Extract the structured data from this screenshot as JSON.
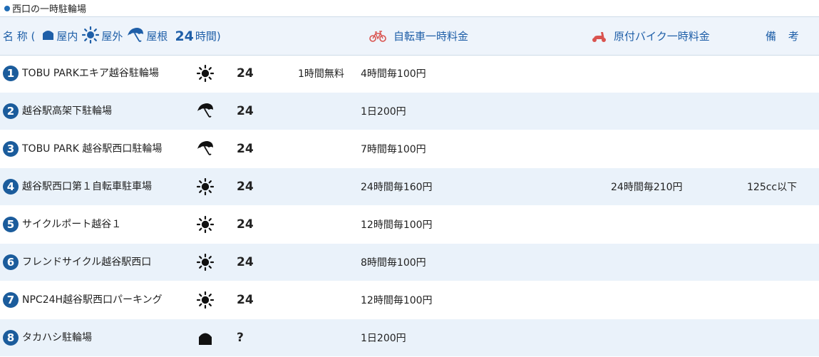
{
  "section_title": "西口の一時駐輪場",
  "header": {
    "name_label": "名 称 (",
    "indoor": "屋内",
    "outdoor": "屋外",
    "roof": "屋根",
    "hours_num": "24",
    "hours_label": "時間)",
    "bike_fee": "自転車一時料金",
    "moto_fee": "原付バイク一時料金",
    "note": "備 考"
  },
  "colors": {
    "accent": "#1f5fa8",
    "row_alt": "#eaf2fa",
    "number_badge": "#1b5c9c"
  },
  "rows": [
    {
      "num": "1",
      "name": "TOBU PARKエキア越谷駐輪場",
      "type": "sun-icon",
      "hours": "24",
      "free": "1時間無料",
      "bike": "4時間毎100円",
      "moto": "",
      "note": ""
    },
    {
      "num": "2",
      "name": "越谷駅高架下駐輪場",
      "type": "umbrella-icon",
      "hours": "24",
      "free": "",
      "bike": "1日200円",
      "moto": "",
      "note": ""
    },
    {
      "num": "3",
      "name": "TOBU PARK 越谷駅西口駐輪場",
      "type": "umbrella-icon",
      "hours": "24",
      "free": "",
      "bike": "7時間毎100円",
      "moto": "",
      "note": ""
    },
    {
      "num": "4",
      "name": "越谷駅西口第１自転車駐車場",
      "type": "sun-icon",
      "hours": "24",
      "free": "",
      "bike": "24時間毎160円",
      "moto": "24時間毎210円",
      "note": "125cc以下"
    },
    {
      "num": "5",
      "name": "サイクルポート越谷１",
      "type": "sun-icon",
      "hours": "24",
      "free": "",
      "bike": "12時間毎100円",
      "moto": "",
      "note": ""
    },
    {
      "num": "6",
      "name": "フレンドサイクル越谷駅西口",
      "type": "sun-icon",
      "hours": "24",
      "free": "",
      "bike": "8時間毎100円",
      "moto": "",
      "note": ""
    },
    {
      "num": "7",
      "name": "NPC24H越谷駅西口パーキング",
      "type": "sun-icon",
      "hours": "24",
      "free": "",
      "bike": "12時間毎100円",
      "moto": "",
      "note": ""
    },
    {
      "num": "8",
      "name": "タカハシ駐輪場",
      "type": "house-icon",
      "hours": "?",
      "free": "",
      "bike": "1日200円",
      "moto": "",
      "note": ""
    }
  ]
}
